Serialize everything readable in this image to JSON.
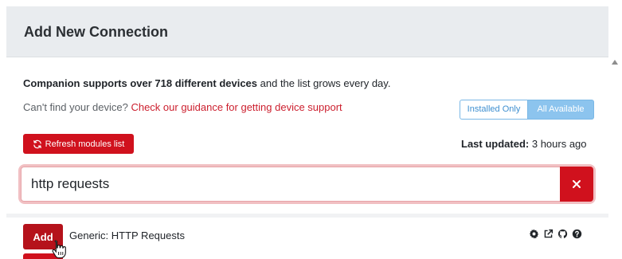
{
  "header": {
    "title": "Add New Connection"
  },
  "info": {
    "support_bold": "Companion supports over 718 different devices",
    "support_rest": " and the list grows every day.",
    "guidance_prefix": "Can't find your device? ",
    "guidance_link": "Check our guidance for getting device support"
  },
  "toggle": {
    "installed_only": "Installed Only",
    "all_available": "All Available",
    "selected": "All Available"
  },
  "refresh": {
    "label": "Refresh modules list",
    "icon": "refresh-icon"
  },
  "last_updated": {
    "label": "Last updated:",
    "value": " 3 hours ago"
  },
  "search": {
    "value": "http requests",
    "placeholder": ""
  },
  "results": [
    {
      "add_label": "Add",
      "name": "Generic: HTTP Requests",
      "icons": [
        "gear-icon",
        "external-link-icon",
        "github-icon",
        "help-icon"
      ]
    }
  ],
  "colors": {
    "accent_red": "#d0111d",
    "link_red": "#cc1f2e",
    "toggle_blue": "#8cc4ee"
  }
}
